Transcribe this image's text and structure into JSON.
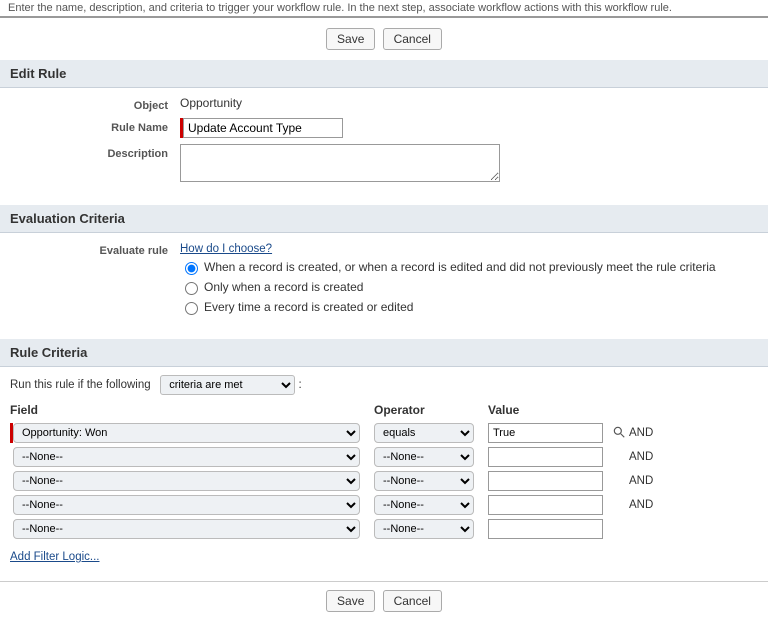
{
  "top_text": "Enter the name, description, and criteria to trigger your workflow rule. In the next step, associate workflow actions with this workflow rule.",
  "buttons": {
    "save": "Save",
    "cancel": "Cancel"
  },
  "sections": {
    "edit_rule": "Edit Rule",
    "evaluation": "Evaluation Criteria",
    "rule_criteria": "Rule Criteria"
  },
  "edit_rule": {
    "object_label": "Object",
    "object_value": "Opportunity",
    "rule_name_label": "Rule Name",
    "rule_name_value": "Update Account Type",
    "description_label": "Description",
    "description_value": ""
  },
  "evaluation": {
    "label": "Evaluate rule",
    "help_link": "How do I choose?",
    "options": [
      {
        "label": "When a record is created, or when a record is edited and did not previously meet the rule criteria",
        "checked": true
      },
      {
        "label": "Only when a record is created",
        "checked": false
      },
      {
        "label": "Every time a record is created or edited",
        "checked": false
      }
    ]
  },
  "rule_criteria": {
    "intro": "Run this rule if the following",
    "mode": "criteria are met",
    "colon": ":",
    "headers": {
      "field": "Field",
      "operator": "Operator",
      "value": "Value"
    },
    "join_word": "AND",
    "rows": [
      {
        "field": "Opportunity: Won",
        "operator": "equals",
        "value": "True",
        "lookup": true,
        "required": true,
        "join": true
      },
      {
        "field": "--None--",
        "operator": "--None--",
        "value": "",
        "lookup": false,
        "required": false,
        "join": true
      },
      {
        "field": "--None--",
        "operator": "--None--",
        "value": "",
        "lookup": false,
        "required": false,
        "join": true
      },
      {
        "field": "--None--",
        "operator": "--None--",
        "value": "",
        "lookup": false,
        "required": false,
        "join": true
      },
      {
        "field": "--None--",
        "operator": "--None--",
        "value": "",
        "lookup": false,
        "required": false,
        "join": false
      }
    ],
    "add_filter": "Add Filter Logic..."
  }
}
